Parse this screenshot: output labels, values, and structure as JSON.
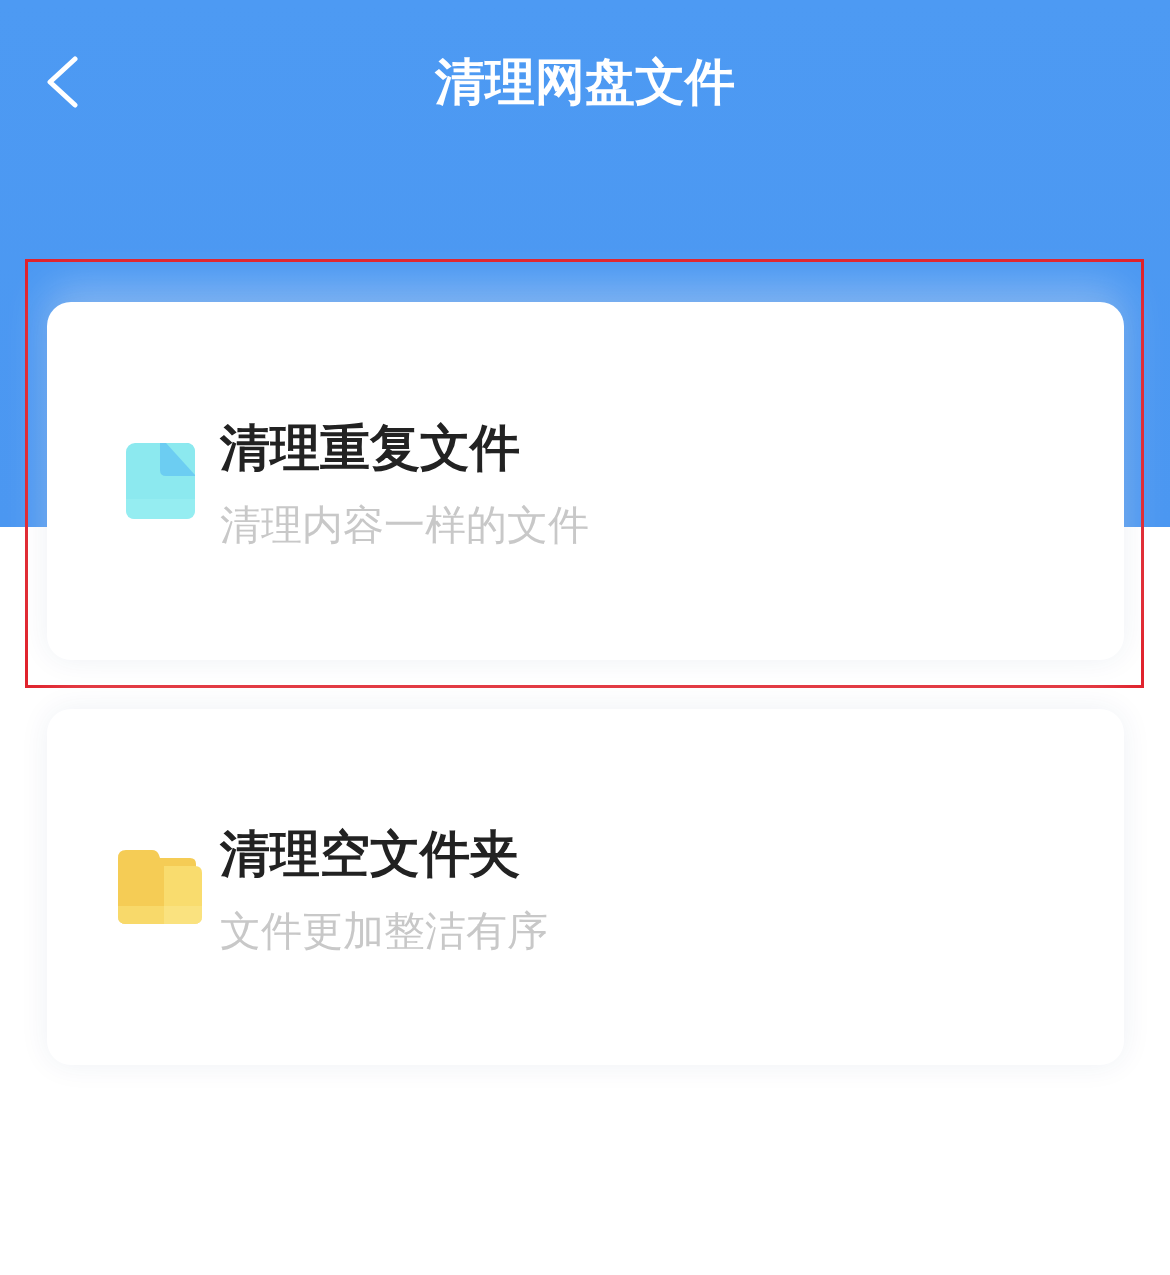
{
  "header": {
    "title": "清理网盘文件"
  },
  "options": [
    {
      "kind": "document",
      "title": "清理重复文件",
      "subtitle": "清理内容一样的文件",
      "highlighted": true
    },
    {
      "kind": "folder",
      "title": "清理空文件夹",
      "subtitle": "文件更加整洁有序",
      "highlighted": false
    }
  ]
}
